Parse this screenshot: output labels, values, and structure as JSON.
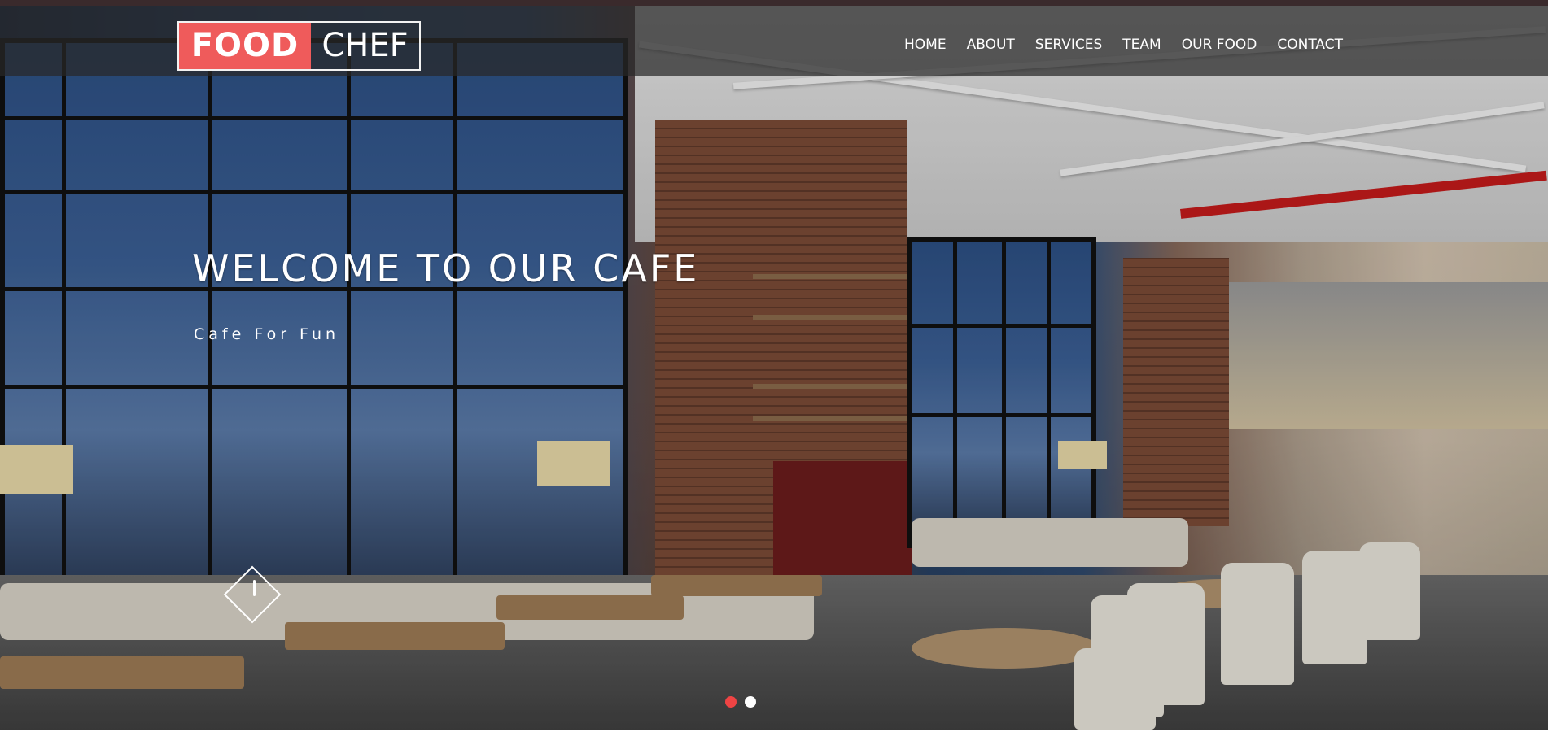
{
  "brand": {
    "logo_part1": "FOOD",
    "logo_part2": "CHEF",
    "accent_color": "#ef5b5b"
  },
  "nav": {
    "items": [
      {
        "label": "HOME"
      },
      {
        "label": "ABOUT"
      },
      {
        "label": "SERVICES"
      },
      {
        "label": "TEAM"
      },
      {
        "label": "OUR FOOD"
      },
      {
        "label": "CONTACT"
      }
    ]
  },
  "hero": {
    "title": "WELCOME TO OUR CAFE",
    "subtitle": "Cafe For Fun",
    "scroll_icon": "scroll-down-icon"
  },
  "slider": {
    "active_slide": 1,
    "slide_count": 2,
    "active_dot_color": "#ef4444",
    "inactive_dot_color": "#ffffff"
  }
}
